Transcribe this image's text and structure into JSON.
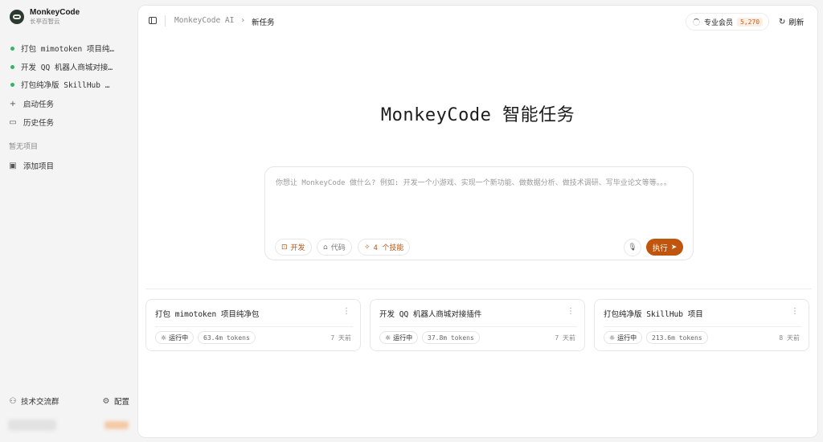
{
  "brand": {
    "name": "MonkeyCode",
    "subtitle": "长亭百智云"
  },
  "sidebar": {
    "tasks": [
      {
        "label": "打包 mimotoken 项目纯…"
      },
      {
        "label": "开发 QQ 机器人商城对接…"
      },
      {
        "label": "打包纯净版 SkillHub …"
      }
    ],
    "start_task": "启动任务",
    "history": "历史任务",
    "no_project": "暂无项目",
    "add_project": "添加项目",
    "community": "技术交流群",
    "settings": "配置"
  },
  "topbar": {
    "crumb_root": "MonkeyCode AI",
    "crumb_sep": "›",
    "crumb_current": "新任务",
    "member_label": "专业会员",
    "member_points": "5,270",
    "refresh": "刷新"
  },
  "hero": {
    "title": "MonkeyCode 智能任务"
  },
  "prompt": {
    "placeholder": "你想让 MonkeyCode 做什么? 例如: 开发一个小游戏、实现一个新功能、做数据分析、做技术调研、写毕业论文等等。。。",
    "chip_dev": "开发",
    "chip_code": "代码",
    "chip_skills": "4 个技能",
    "run": "执行"
  },
  "cards": [
    {
      "title": "打包 mimotoken 项目纯净包",
      "status": "运行中",
      "tokens": "63.4m tokens",
      "time": "7 天前"
    },
    {
      "title": "开发 QQ 机器人商城对接插件",
      "status": "运行中",
      "tokens": "37.8m tokens",
      "time": "7 天前"
    },
    {
      "title": "打包纯净版 SkillHub 项目",
      "status": "运行中",
      "tokens": "213.6m tokens",
      "time": "8 天前"
    }
  ],
  "colors": {
    "accent": "#c0550e",
    "running_dot": "#2fb865"
  },
  "icons": {
    "plus": "plus-icon",
    "folder": "folder-icon",
    "users": "users-icon",
    "gear": "gear-icon",
    "mic": "mic-icon",
    "send": "send-icon"
  }
}
